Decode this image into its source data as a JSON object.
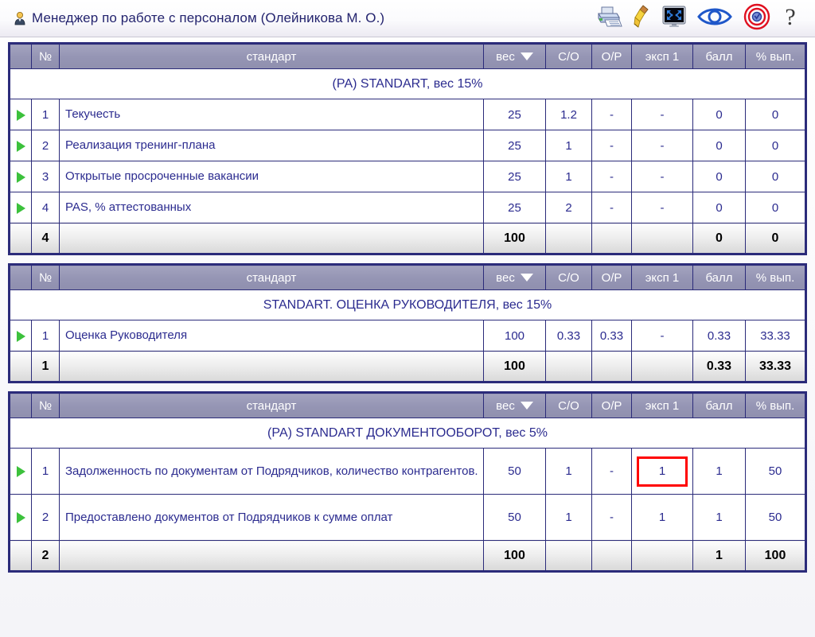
{
  "titlebar": {
    "title": "Менеджер по работе с персоналом  (Олейникова М. О.)",
    "user_icon": "user-icon",
    "icons": [
      {
        "name": "print-icon",
        "label": "Печать"
      },
      {
        "name": "brush-icon",
        "label": "Очистить"
      },
      {
        "name": "fullscreen-icon",
        "label": "Во весь экран"
      },
      {
        "name": "eye-icon",
        "label": "Просмотр"
      },
      {
        "name": "target-icon",
        "label": "Цели"
      },
      {
        "name": "help-icon",
        "label": "?"
      }
    ]
  },
  "columns": {
    "arrow": "",
    "num": "№",
    "standard": "стандарт",
    "ves": "вес",
    "so": "С/О",
    "op": "О/Р",
    "exp1": "эксп 1",
    "ball": "балл",
    "proc": "% вып."
  },
  "blocks": [
    {
      "group_title": "(РА) STANDART, вес 15%",
      "rows": [
        {
          "num": "1",
          "standard": "Текучесть",
          "ves": "25",
          "so": "1.2",
          "op": "-",
          "exp1": "-",
          "ball": "0",
          "proc": "0"
        },
        {
          "num": "2",
          "standard": "Реализация тренинг-плана",
          "ves": "25",
          "so": "1",
          "op": "-",
          "exp1": "-",
          "ball": "0",
          "proc": "0"
        },
        {
          "num": "3",
          "standard": "Открытые просроченные вакансии",
          "ves": "25",
          "so": "1",
          "op": "-",
          "exp1": "-",
          "ball": "0",
          "proc": "0"
        },
        {
          "num": "4",
          "standard": "PAS, % аттестованных",
          "ves": "25",
          "so": "2",
          "op": "-",
          "exp1": "-",
          "ball": "0",
          "proc": "0"
        }
      ],
      "total": {
        "num": "4",
        "standard": "",
        "ves": "100",
        "so": "",
        "op": "",
        "exp1": "",
        "ball": "0",
        "proc": "0"
      }
    },
    {
      "group_title": "STANDART. ОЦЕНКА РУКОВОДИТЕЛЯ, вес 15%",
      "rows": [
        {
          "num": "1",
          "standard": "Оценка Руководителя",
          "ves": "100",
          "so": "0.33",
          "op": "0.33",
          "exp1": "-",
          "ball": "0.33",
          "proc": "33.33"
        }
      ],
      "total": {
        "num": "1",
        "standard": "",
        "ves": "100",
        "so": "",
        "op": "",
        "exp1": "",
        "ball": "0.33",
        "proc": "33.33"
      }
    },
    {
      "group_title": "(РА) STANDART ДОКУМЕНТООБОРОТ, вес 5%",
      "rows": [
        {
          "num": "1",
          "standard": "Задолженность по документам от Подрядчиков, количество контрагентов.",
          "ves": "50",
          "so": "1",
          "op": "-",
          "exp1": "1",
          "ball": "1",
          "proc": "50",
          "tall": true,
          "exp1_focused": true
        },
        {
          "num": "2",
          "standard": "Предоставлено документов от Подрядчиков к сумме оплат",
          "ves": "50",
          "so": "1",
          "op": "-",
          "exp1": "1",
          "ball": "1",
          "proc": "50",
          "tall": true
        }
      ],
      "total": {
        "num": "2",
        "standard": "",
        "ves": "100",
        "so": "",
        "op": "",
        "exp1": "",
        "ball": "1",
        "proc": "100"
      }
    }
  ],
  "colors": {
    "grid_border": "#2b2b7a",
    "header_bg": "#9595b4",
    "text_blue": "#2b2b8f",
    "focus_red": "#ff0000",
    "arrow_green": "#3cc13c"
  }
}
